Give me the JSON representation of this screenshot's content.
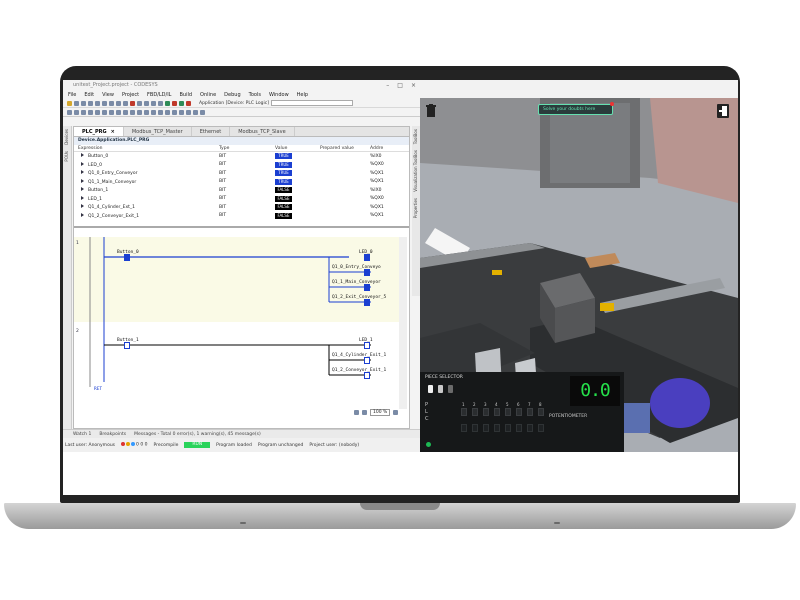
{
  "ide": {
    "title": "unitest_Project.project - CODESYS",
    "window_buttons": [
      "–",
      "□",
      "×"
    ],
    "menu": [
      "File",
      "Edit",
      "View",
      "Project",
      "FBD/LD/IL",
      "Build",
      "Online",
      "Debug",
      "Tools",
      "Window",
      "Help"
    ],
    "application_label": "Application [Device: PLC Logic]",
    "tabs": [
      {
        "label": "PLC_PRG",
        "active": true
      },
      {
        "label": "Modbus_TCP_Master",
        "active": false
      },
      {
        "label": "Ethernet",
        "active": false
      },
      {
        "label": "Modbus_TCP_Slave",
        "active": false
      }
    ],
    "path": "Device.Application.PLC_PRG",
    "watch_columns": [
      "Expression",
      "Type",
      "Value",
      "Prepared value",
      "Addre"
    ],
    "watch_rows": [
      {
        "expr": "Button_0",
        "type": "BIT",
        "value": "TRUE",
        "addr": "%IX0"
      },
      {
        "expr": "LED_0",
        "type": "BIT",
        "value": "TRUE",
        "addr": "%QX0"
      },
      {
        "expr": "Q1_0_Entry_Conveyor",
        "type": "BIT",
        "value": "TRUE",
        "addr": "%QX1"
      },
      {
        "expr": "Q1_1_Main_Conveyor",
        "type": "BIT",
        "value": "TRUE",
        "addr": "%QX1"
      },
      {
        "expr": "Button_1",
        "type": "BIT",
        "value": "FALSE",
        "addr": "%IX0"
      },
      {
        "expr": "LED_1",
        "type": "BIT",
        "value": "FALSE",
        "addr": "%QX0"
      },
      {
        "expr": "Q1_4_Cylinder_Ext_1",
        "type": "BIT",
        "value": "FALSE",
        "addr": "%QX1"
      },
      {
        "expr": "Q1_2_Conveyor_Exit_1",
        "type": "BIT",
        "value": "FALSE",
        "addr": "%QX1"
      }
    ],
    "ladder": {
      "rung1_num": "1",
      "rung2_num": "2",
      "contact1": "Button_0",
      "coil1": "LED_0",
      "coil1b": "Q1_0_Entry_Conveyo",
      "coil1c": "Q1_1_Main_Conveyor",
      "coil1d": "Q1_2_Exit_Conveyor_5",
      "contact2": "Button_1",
      "coil2": "LED_1",
      "coil2b": "Q1_4_Cylinder_Exit_1",
      "coil2c": "Q1_2_Conveyor_Exit_1",
      "end_label": "RET"
    },
    "zoom": "100 %",
    "bottom_tabs": [
      "Watch 1",
      "Breakpoints",
      "Messages - Total 0 error(s), 1 warning(s), 45 message(s)"
    ],
    "vertical_tabs_left": [
      "Devices",
      "POUs"
    ],
    "vertical_tabs_right": [
      "ToolBox",
      "Visualization ToolBox",
      "Properties"
    ],
    "status": {
      "user": "Last user: Anonymous",
      "counts": "0  0  0",
      "precompile": "Precompile",
      "run": "RUN",
      "loaded": "Program loaded",
      "unchanged": "Program unchanged",
      "project_user": "Project user: (nobody)"
    }
  },
  "sim": {
    "doubts_button": "Solve your doubts here",
    "panel": {
      "title": "PIECE SELECTOR",
      "plc_letters": [
        "P",
        "L",
        "C"
      ],
      "digits": [
        "1",
        "2",
        "3",
        "4",
        "5",
        "6",
        "7",
        "8"
      ],
      "potentiometer_label": "POTENTIOMETER",
      "display": "0.0"
    }
  }
}
